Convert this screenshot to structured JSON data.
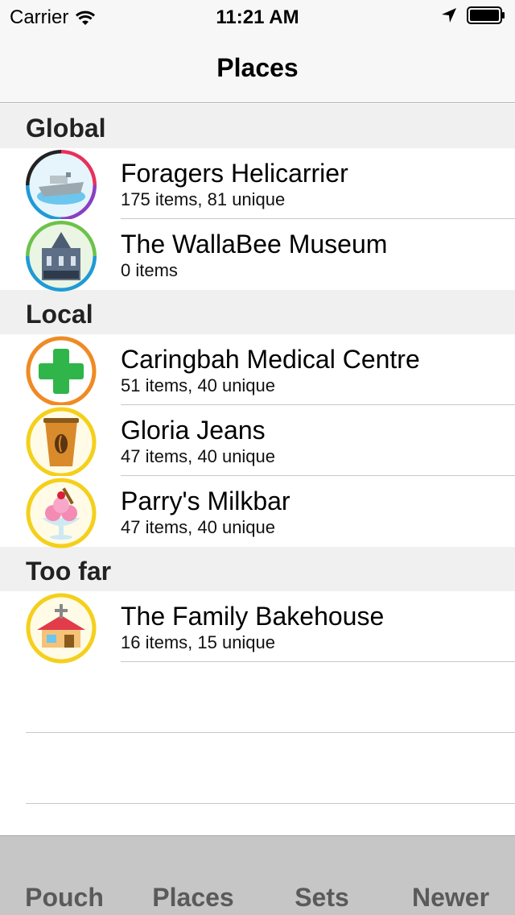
{
  "status_bar": {
    "carrier": "Carrier",
    "time": "11:21 AM"
  },
  "nav": {
    "title": "Places"
  },
  "sections": [
    {
      "header": "Global",
      "rows": [
        {
          "title": "Foragers Helicarrier",
          "subtitle": "175 items, 81 unique",
          "icon": "helicarrier-icon"
        },
        {
          "title": "The WallaBee Museum",
          "subtitle": "0 items",
          "icon": "museum-icon"
        }
      ]
    },
    {
      "header": "Local",
      "rows": [
        {
          "title": "Caringbah Medical Centre",
          "subtitle": "51 items, 40 unique",
          "icon": "medical-cross-icon"
        },
        {
          "title": "Gloria Jeans",
          "subtitle": "47 items, 40 unique",
          "icon": "coffee-cup-icon"
        },
        {
          "title": "Parry's Milkbar",
          "subtitle": "47 items, 40 unique",
          "icon": "ice-cream-sundae-icon"
        }
      ]
    },
    {
      "header": "Too far",
      "rows": [
        {
          "title": "The Family Bakehouse",
          "subtitle": "16 items, 15 unique",
          "icon": "bakehouse-icon"
        }
      ]
    }
  ],
  "tabs": {
    "pouch": "Pouch",
    "places": "Places",
    "sets": "Sets",
    "newer": "Newer"
  },
  "colors": {
    "nav_background": "#f7f7f7",
    "section_background": "#f0f0f0",
    "tab_bar_background": "#c6c6c6",
    "medical_ring": "#f08a24",
    "food_ring": "#f4d01c"
  }
}
